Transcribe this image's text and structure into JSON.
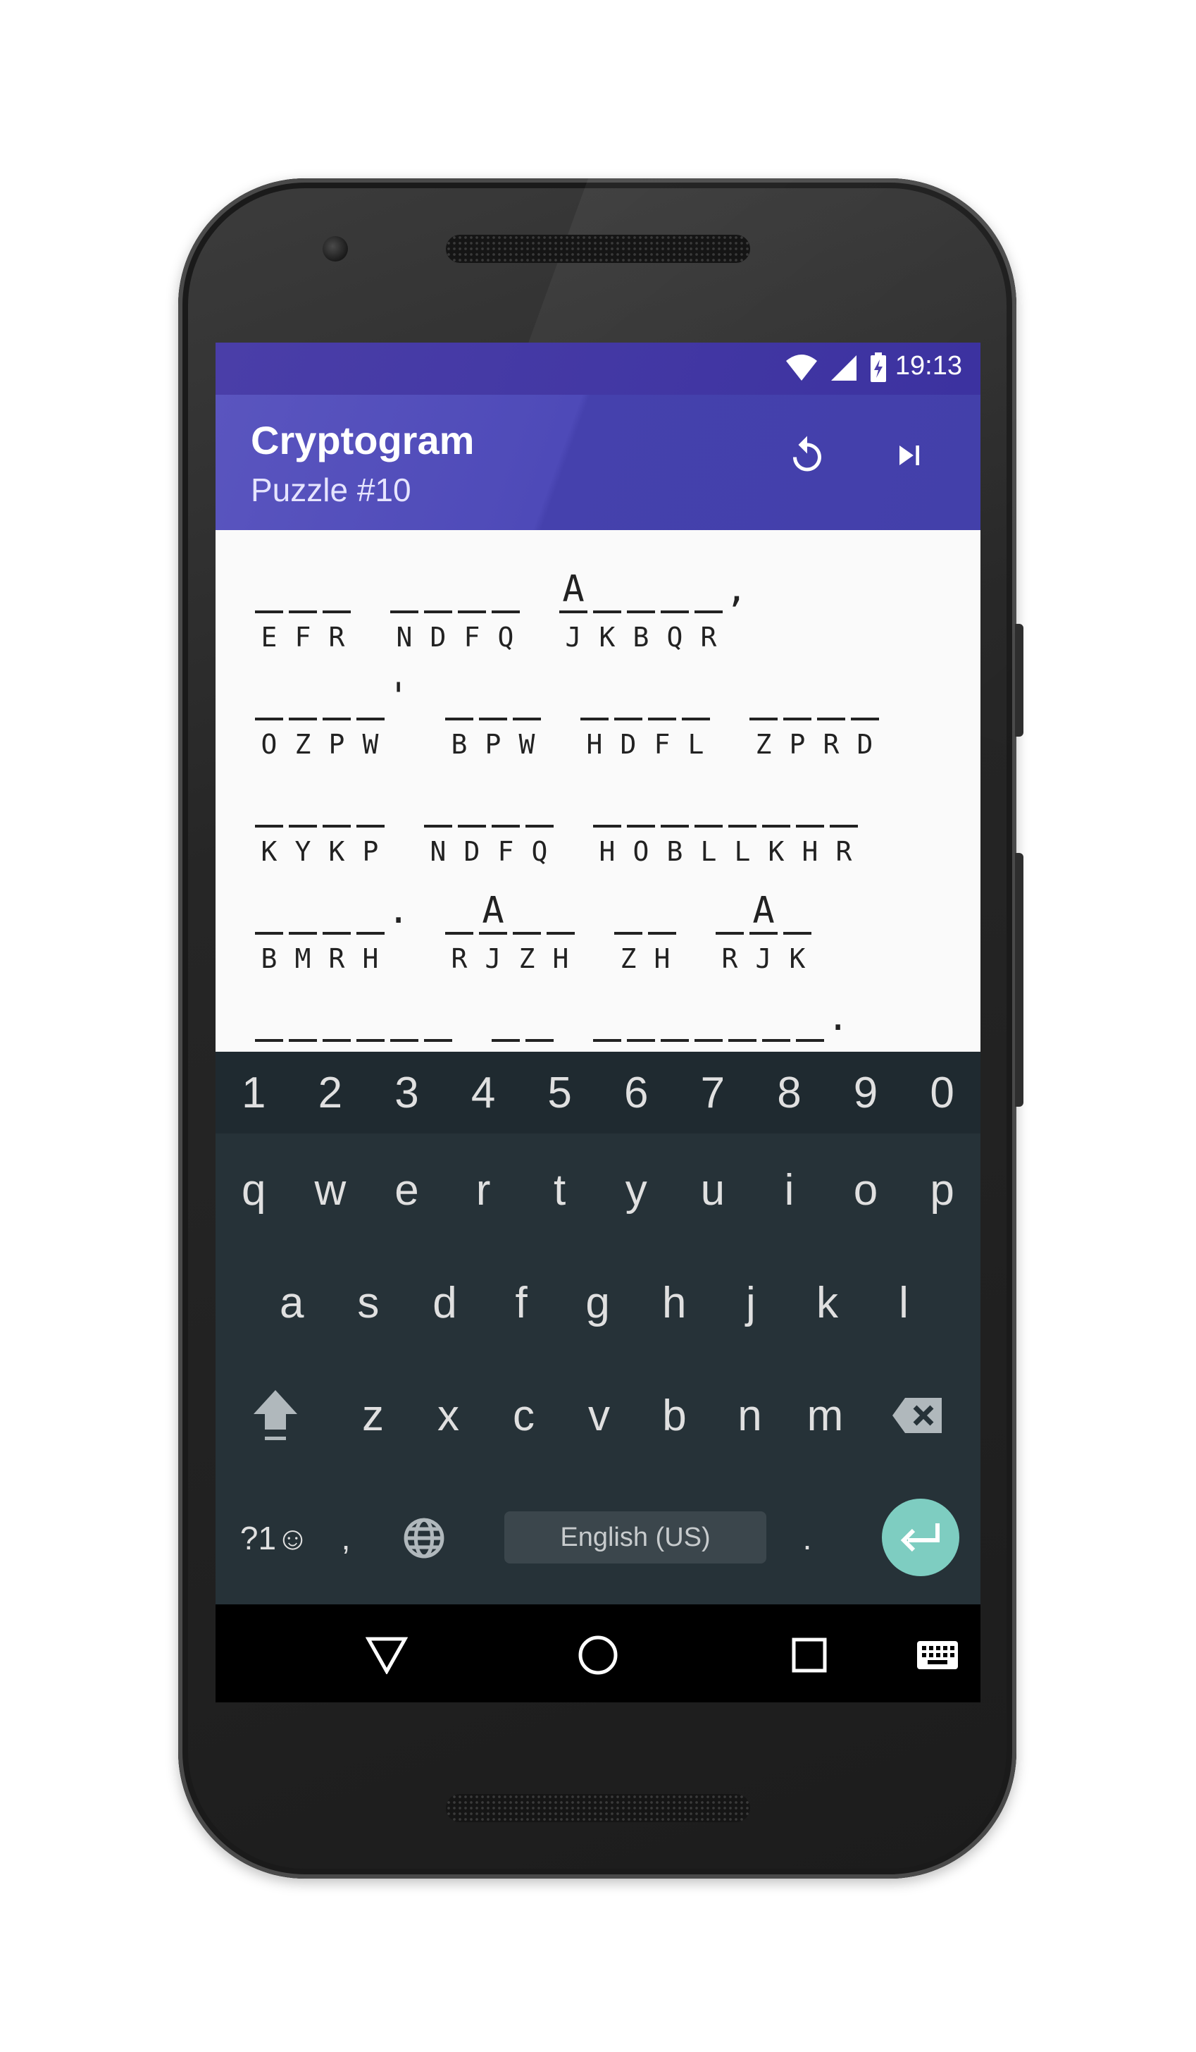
{
  "status_bar": {
    "time": "19:13",
    "icons": [
      "wifi-icon",
      "cell-signal-icon",
      "battery-charging-icon"
    ]
  },
  "app_bar": {
    "title": "Cryptogram",
    "subtitle": "Puzzle #10",
    "actions": [
      "restart-icon",
      "skip-next-icon"
    ]
  },
  "puzzle": {
    "lines": [
      {
        "words": [
          {
            "cells": [
              {
                "g": "",
                "c": "E"
              },
              {
                "g": "",
                "c": "F"
              },
              {
                "g": "",
                "c": "R"
              }
            ]
          },
          {
            "cells": [
              {
                "g": "",
                "c": "N"
              },
              {
                "g": "",
                "c": "D"
              },
              {
                "g": "",
                "c": "F"
              },
              {
                "g": "",
                "c": "Q"
              }
            ]
          },
          {
            "cells": [
              {
                "g": "A",
                "c": "J"
              },
              {
                "g": "",
                "c": "K"
              },
              {
                "g": "",
                "c": "B"
              },
              {
                "g": "",
                "c": "Q"
              },
              {
                "g": "",
                "c": "R"
              }
            ],
            "after": ","
          }
        ]
      },
      {
        "words": [
          {
            "cells": [
              {
                "g": "",
                "c": "O"
              },
              {
                "g": "",
                "c": "Z"
              },
              {
                "g": "",
                "c": "P"
              },
              {
                "g": "",
                "c": "W"
              }
            ],
            "after": "'"
          },
          {
            "cells": [
              {
                "g": "",
                "c": "B"
              },
              {
                "g": "",
                "c": "P"
              },
              {
                "g": "",
                "c": "W"
              }
            ]
          },
          {
            "cells": [
              {
                "g": "",
                "c": "H"
              },
              {
                "g": "",
                "c": "D"
              },
              {
                "g": "",
                "c": "F"
              },
              {
                "g": "",
                "c": "L"
              }
            ]
          },
          {
            "cells": [
              {
                "g": "",
                "c": "Z"
              },
              {
                "g": "",
                "c": "P"
              },
              {
                "g": "",
                "c": "R"
              },
              {
                "g": "",
                "c": "D"
              }
            ]
          }
        ]
      },
      {
        "words": [
          {
            "cells": [
              {
                "g": "",
                "c": "K"
              },
              {
                "g": "",
                "c": "Y"
              },
              {
                "g": "",
                "c": "K"
              },
              {
                "g": "",
                "c": "P"
              }
            ]
          },
          {
            "cells": [
              {
                "g": "",
                "c": "N"
              },
              {
                "g": "",
                "c": "D"
              },
              {
                "g": "",
                "c": "F"
              },
              {
                "g": "",
                "c": "Q"
              }
            ]
          },
          {
            "cells": [
              {
                "g": "",
                "c": "H"
              },
              {
                "g": "",
                "c": "O"
              },
              {
                "g": "",
                "c": "B"
              },
              {
                "g": "",
                "c": "L"
              },
              {
                "g": "",
                "c": "L"
              },
              {
                "g": "",
                "c": "K"
              },
              {
                "g": "",
                "c": "H"
              },
              {
                "g": "",
                "c": "R"
              }
            ]
          }
        ]
      },
      {
        "words": [
          {
            "cells": [
              {
                "g": "",
                "c": "B"
              },
              {
                "g": "",
                "c": "M"
              },
              {
                "g": "",
                "c": "R"
              },
              {
                "g": "",
                "c": "H"
              }
            ],
            "after": "."
          },
          {
            "cells": [
              {
                "g": "",
                "c": "R"
              },
              {
                "g": "A",
                "c": "J"
              },
              {
                "g": "",
                "c": "Z"
              },
              {
                "g": "",
                "c": "H"
              }
            ]
          },
          {
            "cells": [
              {
                "g": "",
                "c": "Z"
              },
              {
                "g": "",
                "c": "H"
              }
            ]
          },
          {
            "cells": [
              {
                "g": "",
                "c": "R"
              },
              {
                "g": "A",
                "c": "J"
              },
              {
                "g": "",
                "c": "K"
              }
            ]
          }
        ]
      },
      {
        "words": [
          {
            "cells": [
              {
                "g": "",
                "c": ""
              },
              {
                "g": "",
                "c": ""
              },
              {
                "g": "",
                "c": ""
              },
              {
                "g": "",
                "c": ""
              },
              {
                "g": "",
                "c": ""
              },
              {
                "g": "",
                "c": ""
              }
            ]
          },
          {
            "cells": [
              {
                "g": "",
                "c": ""
              },
              {
                "g": "",
                "c": ""
              }
            ]
          },
          {
            "cells": [
              {
                "g": "",
                "c": ""
              },
              {
                "g": "",
                "c": ""
              },
              {
                "g": "",
                "c": ""
              },
              {
                "g": "",
                "c": ""
              },
              {
                "g": "",
                "c": ""
              },
              {
                "g": "",
                "c": ""
              },
              {
                "g": "",
                "c": ""
              }
            ],
            "after": "."
          }
        ]
      }
    ]
  },
  "keyboard": {
    "number_row": [
      "1",
      "2",
      "3",
      "4",
      "5",
      "6",
      "7",
      "8",
      "9",
      "0"
    ],
    "row1": [
      "q",
      "w",
      "e",
      "r",
      "t",
      "y",
      "u",
      "i",
      "o",
      "p"
    ],
    "row2": [
      "a",
      "s",
      "d",
      "f",
      "g",
      "h",
      "j",
      "k",
      "l"
    ],
    "row3": [
      "z",
      "x",
      "c",
      "v",
      "b",
      "n",
      "m"
    ],
    "symbols_label": "?1☺",
    "comma": ",",
    "period": ".",
    "space_label": "English (US)",
    "icons": [
      "shift-icon",
      "backspace-icon",
      "globe-icon",
      "enter-icon"
    ]
  },
  "nav_bar": {
    "icons": [
      "back-icon",
      "home-icon",
      "recents-icon",
      "keyboard-icon"
    ]
  },
  "colors": {
    "app_bar": "#4e4ab8",
    "status_bar": "#4a3ea8",
    "keyboard_bg": "#263238",
    "enter_key": "#7ecdc1"
  }
}
